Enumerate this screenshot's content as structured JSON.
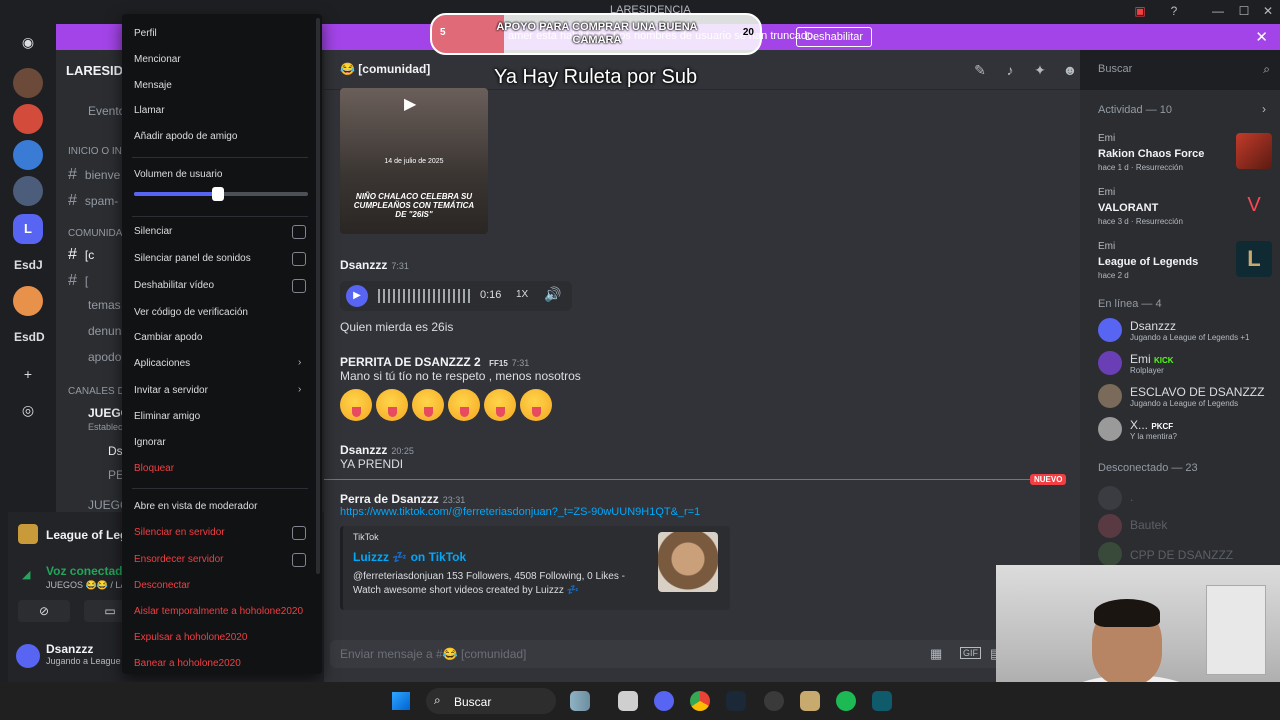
{
  "window": {
    "title": "LARESIDENCIA"
  },
  "banner": {
    "text": "amer está habilitado. Los nombres de usuario se han truncado.",
    "button_label": "Deshabilitar",
    "close_icon": "close-icon"
  },
  "rail": {
    "labels": [
      "EsdJ",
      "EsdD"
    ]
  },
  "sidebar": {
    "server_name": "LARESIDE",
    "channels": [
      {
        "label": "Evento"
      },
      {
        "label": "INICIO O INF"
      },
      {
        "label": "bienve"
      },
      {
        "label": "spam-"
      },
      {
        "label": "COMUNIDA"
      },
      {
        "label": "[c"
      },
      {
        "label": "["
      },
      {
        "label": "temas"
      },
      {
        "label": "denun"
      },
      {
        "label": "apodo"
      },
      {
        "label": "CANALES D"
      },
      {
        "label": "JUEGO"
      },
      {
        "label": "Establec"
      },
      {
        "label": "Ds"
      },
      {
        "label": "PE"
      },
      {
        "label": "JUEGO"
      }
    ],
    "activity_card": {
      "title": "League of Lege"
    },
    "voice": {
      "status": "Voz conectada",
      "channel": "JUEGOS 😂😂 / LA"
    },
    "user": {
      "name": "Dsanzzz",
      "status": "Jugando a League"
    }
  },
  "chat": {
    "channel_name": "[comunidad]",
    "video": {
      "date": "14 de julio de 2025",
      "caption": "NIÑO CHALACO CELEBRA SU CUMPLEAÑOS CON TEMÁTICA DE \"26IS\""
    },
    "messages": [
      {
        "author": "Dsanzzz",
        "time": "7:31",
        "text": ""
      },
      {
        "author": "",
        "time": "",
        "text": "Quien mierda es 26is"
      },
      {
        "author": "PERRITA DE DSANZZZ 2",
        "badge": "FF15",
        "time": "7:31",
        "text": "Mano si tú tío no te respeto , menos nosotros"
      },
      {
        "author": "Dsanzzz",
        "time": "20:25",
        "text": "YA PRENDI"
      },
      {
        "author": "Perra de Dsanzzz",
        "time": "23:31",
        "text": "https://www.tiktok.com/@ferreteriasdonjuan?_t=ZS-90wUUN9H1QT&_r=1"
      }
    ],
    "audio": {
      "duration": "0:16",
      "speed": "1X"
    },
    "new_badge": "NUEVO",
    "embed": {
      "provider": "TikTok",
      "title": "Luizzz 💤 on TikTok",
      "description": "@ferreteriasdonjuan 153 Followers, 4508 Following, 0 Likes - Watch awesome short videos created by Luizzz 💤"
    },
    "input_placeholder": "Enviar mensaje a #😂 [comunidad]"
  },
  "header": {
    "search_placeholder": "Buscar"
  },
  "members": {
    "activity_header": "Actividad — 10",
    "activities": [
      {
        "user": "Emi",
        "game": "Rakion Chaos Force",
        "ago": "hace 1 d",
        "tag": "Resurrección"
      },
      {
        "user": "Emi",
        "game": "VALORANT",
        "ago": "hace 3 d",
        "tag": "Resurrección"
      },
      {
        "user": "Emi",
        "game": "League of Legends",
        "ago": "hace 2 d",
        "tag": ""
      }
    ],
    "online_header": "En línea — 4",
    "online": [
      {
        "name": "Dsanzzz",
        "sub": "Jugando a League of Legends +1"
      },
      {
        "name": "Emi",
        "badge": "KICK",
        "sub": "Rolplayer"
      },
      {
        "name": "ESCLAVO DE DSANZZZ",
        "sub": "Jugando a League of Legends"
      },
      {
        "name": "X...",
        "badge": "PKCF",
        "sub": "Y la mentira?"
      }
    ],
    "offline_header": "Desconectado — 23",
    "offline": [
      {
        "name": "."
      },
      {
        "name": "Bautek"
      },
      {
        "name": "CPP DE DSANZZZ"
      }
    ]
  },
  "menu": {
    "items_top": [
      "Perfil",
      "Mencionar",
      "Mensaje",
      "Llamar",
      "Añadir apodo de amigo"
    ],
    "volume_label": "Volumen de usuario",
    "volume_level": 0.48,
    "toggles": [
      "Silenciar",
      "Silenciar panel de sonidos",
      "Deshabilitar vídeo"
    ],
    "items_mid": [
      "Ver código de verificación",
      "Cambiar apodo",
      "Aplicaciones",
      "Invitar a servidor",
      "Eliminar amigo",
      "Ignorar"
    ],
    "block": "Bloquear",
    "mod_view": "Abre en vista de moderador",
    "server_toggles": [
      "Silenciar en servidor",
      "Ensordecer servidor"
    ],
    "disconnect": "Desconectar",
    "timeout": "Aislar temporalmente a hoholone2020",
    "kick": "Expulsar a hoholone2020",
    "ban": "Banear a hoholone2020"
  },
  "overlay": {
    "goal_text": "APOYO PARA COMPRAR UNA BUENA CAMARA",
    "goal_current": "5",
    "goal_max": "20",
    "ruleta": "Ya Hay Ruleta por Sub"
  },
  "taskbar": {
    "search_placeholder": "Buscar"
  }
}
